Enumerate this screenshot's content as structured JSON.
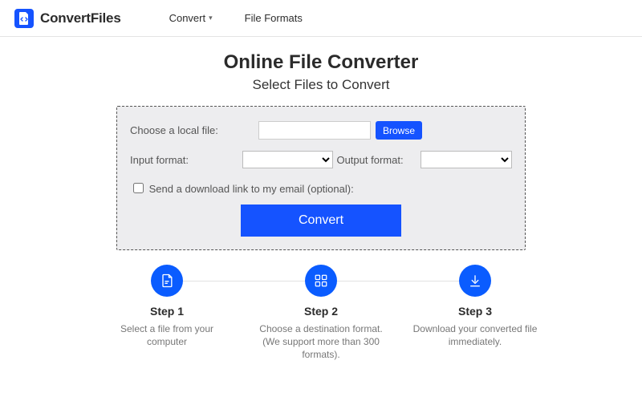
{
  "brand": {
    "name": "ConvertFiles"
  },
  "nav": {
    "convert": "Convert",
    "formats": "File Formats"
  },
  "hero": {
    "title": "Online File Converter",
    "subtitle": "Select Files to Convert"
  },
  "form": {
    "choose_label": "Choose a local file:",
    "browse": "Browse",
    "input_format_label": "Input format:",
    "output_format_label": "Output format:",
    "email_opt": "Send a download link to my email (optional):",
    "convert": "Convert"
  },
  "steps": [
    {
      "title": "Step 1",
      "desc": "Select a file from your computer"
    },
    {
      "title": "Step 2",
      "desc": "Choose a destination format. (We support more than 300 formats)."
    },
    {
      "title": "Step 3",
      "desc": "Download your converted file immediately."
    }
  ]
}
